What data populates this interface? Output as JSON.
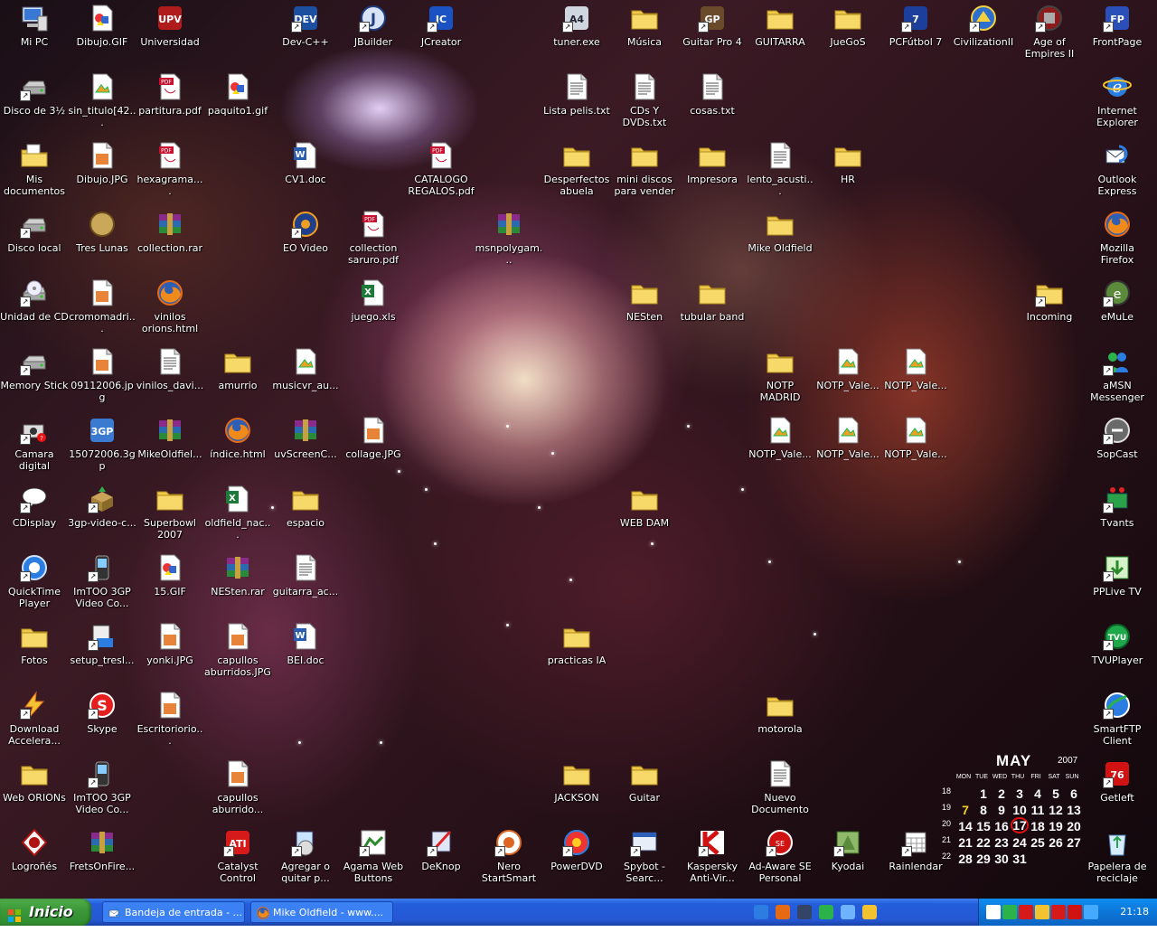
{
  "desktop": {
    "icons": [
      {
        "label": "Mi PC",
        "icon": "my-computer-icon",
        "shortcut": false
      },
      {
        "label": "Dibujo.GIF",
        "icon": "gif-image-icon",
        "shortcut": false
      },
      {
        "label": "Universidad",
        "icon": "upv-logo-icon",
        "shortcut": false
      },
      {
        "label": "Dev-C++",
        "icon": "devcpp-icon",
        "shortcut": true
      },
      {
        "label": "JBuilder",
        "icon": "jbuilder-icon",
        "shortcut": true
      },
      {
        "label": "JCreator",
        "icon": "jcreator-icon",
        "shortcut": true
      },
      {
        "label": "tuner.exe",
        "icon": "tuner-icon",
        "shortcut": true
      },
      {
        "label": "Música",
        "icon": "music-folder-icon",
        "shortcut": false
      },
      {
        "label": "Guitar Pro 4",
        "icon": "guitar-pro-icon",
        "shortcut": true
      },
      {
        "label": "GUITARRA",
        "icon": "folder-icon",
        "shortcut": false
      },
      {
        "label": "JueGoS",
        "icon": "folder-icon",
        "shortcut": false
      },
      {
        "label": "PCFútbol 7",
        "icon": "pcfutbol-icon",
        "shortcut": true
      },
      {
        "label": "CivilizationII",
        "icon": "civilization-icon",
        "shortcut": true
      },
      {
        "label": "Age of Empires II",
        "icon": "age-of-empires-icon",
        "shortcut": true
      },
      {
        "label": "FrontPage",
        "icon": "frontpage-icon",
        "shortcut": true
      },
      {
        "label": "Disco de 3½",
        "icon": "floppy-drive-icon",
        "shortcut": true
      },
      {
        "label": "sin_titulo[42...",
        "icon": "image-file-icon",
        "shortcut": false
      },
      {
        "label": "partitura.pdf",
        "icon": "pdf-icon",
        "shortcut": false
      },
      {
        "label": "paquito1.gif",
        "icon": "gif-image-icon",
        "shortcut": false
      },
      {
        "label": "Lista pelis.txt",
        "icon": "text-file-icon",
        "shortcut": false
      },
      {
        "label": "CDs Y DVDs.txt",
        "icon": "text-file-icon",
        "shortcut": false
      },
      {
        "label": "cosas.txt",
        "icon": "text-file-icon",
        "shortcut": false
      },
      {
        "label": "Internet Explorer",
        "icon": "internet-explorer-icon",
        "shortcut": false
      },
      {
        "label": "Mis documentos",
        "icon": "my-documents-icon",
        "shortcut": false
      },
      {
        "label": "Dibujo.JPG",
        "icon": "jpg-image-icon",
        "shortcut": false
      },
      {
        "label": "hexagrama....",
        "icon": "pdf-icon",
        "shortcut": false
      },
      {
        "label": "CV1.doc",
        "icon": "word-doc-icon",
        "shortcut": false
      },
      {
        "label": "CATALOGO REGALOS.pdf",
        "icon": "pdf-icon",
        "shortcut": false
      },
      {
        "label": "Desperfectos abuela",
        "icon": "folder-icon",
        "shortcut": false
      },
      {
        "label": "mini discos para vender",
        "icon": "folder-icon",
        "shortcut": false
      },
      {
        "label": "Impresora",
        "icon": "folder-icon",
        "shortcut": false
      },
      {
        "label": "lento_acusti...",
        "icon": "text-file-icon",
        "shortcut": false
      },
      {
        "label": "HR",
        "icon": "folder-icon",
        "shortcut": false
      },
      {
        "label": "Outlook Express",
        "icon": "outlook-express-icon",
        "shortcut": false
      },
      {
        "label": "Disco local",
        "icon": "hard-drive-icon",
        "shortcut": true
      },
      {
        "label": "Tres Lunas",
        "icon": "tres-lunas-icon",
        "shortcut": false
      },
      {
        "label": "collection.rar",
        "icon": "rar-archive-icon",
        "shortcut": false
      },
      {
        "label": "EO Video",
        "icon": "eo-video-icon",
        "shortcut": true
      },
      {
        "label": "collection saruro.pdf",
        "icon": "pdf-icon",
        "shortcut": false
      },
      {
        "label": "msnpolygam...",
        "icon": "rar-archive-icon",
        "shortcut": false
      },
      {
        "label": "Mike Oldfield",
        "icon": "folder-icon",
        "shortcut": false
      },
      {
        "label": "Mozilla Firefox",
        "icon": "firefox-icon",
        "shortcut": false
      },
      {
        "label": "Unidad de CD",
        "icon": "cd-drive-icon",
        "shortcut": true
      },
      {
        "label": "cromomadri...",
        "icon": "jpg-image-icon",
        "shortcut": false
      },
      {
        "label": "vinilos orions.html",
        "icon": "firefox-html-icon",
        "shortcut": false
      },
      {
        "label": "juego.xls",
        "icon": "excel-icon",
        "shortcut": false
      },
      {
        "label": "NESten",
        "icon": "folder-icon",
        "shortcut": false
      },
      {
        "label": "tubular band",
        "icon": "folder-icon",
        "shortcut": false
      },
      {
        "label": "Incoming",
        "icon": "folder-icon",
        "shortcut": true
      },
      {
        "label": "eMuLe",
        "icon": "emule-icon",
        "shortcut": true
      },
      {
        "label": "Memory Stick",
        "icon": "removable-drive-icon",
        "shortcut": true
      },
      {
        "label": "09112006.jpg",
        "icon": "jpg-image-icon",
        "shortcut": false
      },
      {
        "label": "vinilos_davi...",
        "icon": "text-file-icon",
        "shortcut": false
      },
      {
        "label": "amurrio",
        "icon": "folder-icon",
        "shortcut": false
      },
      {
        "label": "musicvr_au...",
        "icon": "image-file-icon",
        "shortcut": false
      },
      {
        "label": "NOTP MADRID",
        "icon": "folder-icon",
        "shortcut": false
      },
      {
        "label": "NOTP_Vale...",
        "icon": "image-file-icon",
        "shortcut": false
      },
      {
        "label": "NOTP_Vale...",
        "icon": "image-file-icon",
        "shortcut": false
      },
      {
        "label": "aMSN Messenger",
        "icon": "amsn-icon",
        "shortcut": true
      },
      {
        "label": "Camara digital",
        "icon": "camera-icon",
        "shortcut": true
      },
      {
        "label": "15072006.3gp",
        "icon": "3gp-video-icon",
        "shortcut": false
      },
      {
        "label": "MikeOldfiel...",
        "icon": "rar-archive-icon",
        "shortcut": false
      },
      {
        "label": "índice.html",
        "icon": "firefox-html-icon",
        "shortcut": false
      },
      {
        "label": "uvScreenC...",
        "icon": "rar-archive-icon",
        "shortcut": false
      },
      {
        "label": "collage.JPG",
        "icon": "jpg-image-icon",
        "shortcut": false
      },
      {
        "label": "NOTP_Vale...",
        "icon": "image-file-icon",
        "shortcut": false
      },
      {
        "label": "NOTP_Vale...",
        "icon": "image-file-icon",
        "shortcut": false
      },
      {
        "label": "NOTP_Vale...",
        "icon": "image-file-icon",
        "shortcut": false
      },
      {
        "label": "SopCast",
        "icon": "sopcast-icon",
        "shortcut": true
      },
      {
        "label": "CDisplay",
        "icon": "cdisplay-icon",
        "shortcut": true
      },
      {
        "label": "3gp-video-c...",
        "icon": "install-package-icon",
        "shortcut": true
      },
      {
        "label": "Superbowl 2007",
        "icon": "folder-icon",
        "shortcut": false
      },
      {
        "label": "oldfield_nac...",
        "icon": "excel-icon",
        "shortcut": false
      },
      {
        "label": "espacio",
        "icon": "folder-icon",
        "shortcut": false
      },
      {
        "label": "WEB DAM",
        "icon": "folder-icon",
        "shortcut": false
      },
      {
        "label": "Tvants",
        "icon": "tvants-icon",
        "shortcut": true
      },
      {
        "label": "QuickTime Player",
        "icon": "quicktime-icon",
        "shortcut": true
      },
      {
        "label": "ImTOO 3GP Video Co...",
        "icon": "imtoo-icon",
        "shortcut": true
      },
      {
        "label": "15.GIF",
        "icon": "gif-image-icon",
        "shortcut": false
      },
      {
        "label": "NESten.rar",
        "icon": "rar-archive-icon",
        "shortcut": false
      },
      {
        "label": "guitarra_ac...",
        "icon": "text-file-icon",
        "shortcut": false
      },
      {
        "label": "PPLive TV",
        "icon": "pplive-icon",
        "shortcut": true
      },
      {
        "label": "Fotos",
        "icon": "folder-icon",
        "shortcut": false
      },
      {
        "label": "setup_tresl...",
        "icon": "setup-icon",
        "shortcut": true
      },
      {
        "label": "yonki.JPG",
        "icon": "jpg-image-icon",
        "shortcut": false
      },
      {
        "label": "capullos aburridos.JPG",
        "icon": "jpg-image-icon",
        "shortcut": false
      },
      {
        "label": "BEI.doc",
        "icon": "word-doc-icon",
        "shortcut": false
      },
      {
        "label": "practicas IA",
        "icon": "folder-icon",
        "shortcut": false
      },
      {
        "label": "TVUPlayer",
        "icon": "tvuplayer-icon",
        "shortcut": true
      },
      {
        "label": "Download Accelera...",
        "icon": "download-accelerator-icon",
        "shortcut": true
      },
      {
        "label": "Skype",
        "icon": "skype-icon",
        "shortcut": true
      },
      {
        "label": "Escritoriorio...",
        "icon": "jpg-image-icon",
        "shortcut": false
      },
      {
        "label": "motorola",
        "icon": "folder-icon",
        "shortcut": false
      },
      {
        "label": "SmartFTP Client",
        "icon": "smartftp-icon",
        "shortcut": true
      },
      {
        "label": "Web ORIONs",
        "icon": "folder-icon",
        "shortcut": false
      },
      {
        "label": "ImTOO 3GP Video Co...",
        "icon": "imtoo-icon",
        "shortcut": true
      },
      {
        "label": "capullos aburrido...",
        "icon": "jpg-image-icon",
        "shortcut": false
      },
      {
        "label": "JACKSON",
        "icon": "folder-icon",
        "shortcut": false
      },
      {
        "label": "Guitar",
        "icon": "folder-icon",
        "shortcut": false
      },
      {
        "label": "Nuevo Documento ...",
        "icon": "text-file-icon",
        "shortcut": false
      },
      {
        "label": "Getleft",
        "icon": "getleft-icon",
        "shortcut": true
      },
      {
        "label": "Logroñés",
        "icon": "logrones-badge-icon",
        "shortcut": false
      },
      {
        "label": "FretsOnFire...",
        "icon": "rar-archive-icon",
        "shortcut": false
      },
      {
        "label": "Catalyst Control Center",
        "icon": "ati-icon",
        "shortcut": true
      },
      {
        "label": "Agregar o quitar p...",
        "icon": "add-remove-programs-icon",
        "shortcut": true
      },
      {
        "label": "Agama Web Buttons",
        "icon": "agama-icon",
        "shortcut": true
      },
      {
        "label": "DeKnop",
        "icon": "deknop-icon",
        "shortcut": true
      },
      {
        "label": "Nero StartSmart",
        "icon": "nero-icon",
        "shortcut": true
      },
      {
        "label": "PowerDVD",
        "icon": "powerdvd-icon",
        "shortcut": true
      },
      {
        "label": "Spybot - Searc...",
        "icon": "spybot-icon",
        "shortcut": true
      },
      {
        "label": "Kaspersky Anti-Vir...",
        "icon": "kaspersky-icon",
        "shortcut": true
      },
      {
        "label": "Ad-Aware SE Personal",
        "icon": "adaware-icon",
        "shortcut": true
      },
      {
        "label": "Kyodai",
        "icon": "kyodai-icon",
        "shortcut": true
      },
      {
        "label": "Rainlendar",
        "icon": "rainlendar-icon",
        "shortcut": true
      },
      {
        "label": "Papelera de reciclaje",
        "icon": "recycle-bin-icon",
        "shortcut": false
      }
    ]
  },
  "calendar": {
    "month": "MAY",
    "year": "2007",
    "weekdays": [
      "MON",
      "TUE",
      "WED",
      "THU",
      "FRI",
      "SAT",
      "SUN"
    ],
    "weeks": [
      {
        "num": "18",
        "days": [
          "",
          "",
          "",
          "",
          "",
          "",
          ""
        ]
      },
      {
        "num": "19",
        "days": [
          "",
          "",
          "",
          "",
          "",
          "",
          ""
        ]
      },
      {
        "num": "20",
        "days": [
          "",
          "",
          "",
          "",
          "",
          "",
          ""
        ]
      },
      {
        "num": "21",
        "days": [
          "",
          "",
          "",
          "",
          "",
          "",
          ""
        ]
      },
      {
        "num": "22",
        "days": [
          "",
          "",
          "",
          "",
          "",
          "",
          ""
        ]
      }
    ],
    "grid": [
      [
        "",
        "1",
        "2",
        "3",
        "4",
        "5",
        "6"
      ],
      [
        "7",
        "8",
        "9",
        "10",
        "11",
        "12",
        "13"
      ],
      [
        "14",
        "15",
        "16",
        "17",
        "18",
        "19",
        "20"
      ],
      [
        "21",
        "22",
        "23",
        "24",
        "25",
        "26",
        "27"
      ],
      [
        "28",
        "29",
        "30",
        "31",
        "",
        "",
        ""
      ]
    ],
    "highlight_day": "7",
    "today": "17",
    "colors": {
      "highlight": "#f5d020",
      "today_ring": "#e01010"
    }
  },
  "taskbar": {
    "start_label": "Inicio",
    "tasks": [
      {
        "label": "Bandeja de entrada - ...",
        "icon": "outlook-express-icon"
      },
      {
        "label": "Mike Oldfield - www....",
        "icon": "firefox-icon"
      }
    ],
    "quick_launch": [
      "ie-icon",
      "firefox-icon",
      "outlook-icon",
      "media-player-icon",
      "search-icon",
      "misc-app-icon"
    ],
    "tray_icons": [
      "calendar-17-icon",
      "network-icon",
      "ati-icon",
      "security-shield-icon",
      "ati-icon",
      "kaspersky-icon",
      "wireless-icon"
    ],
    "clock": "21:18"
  }
}
